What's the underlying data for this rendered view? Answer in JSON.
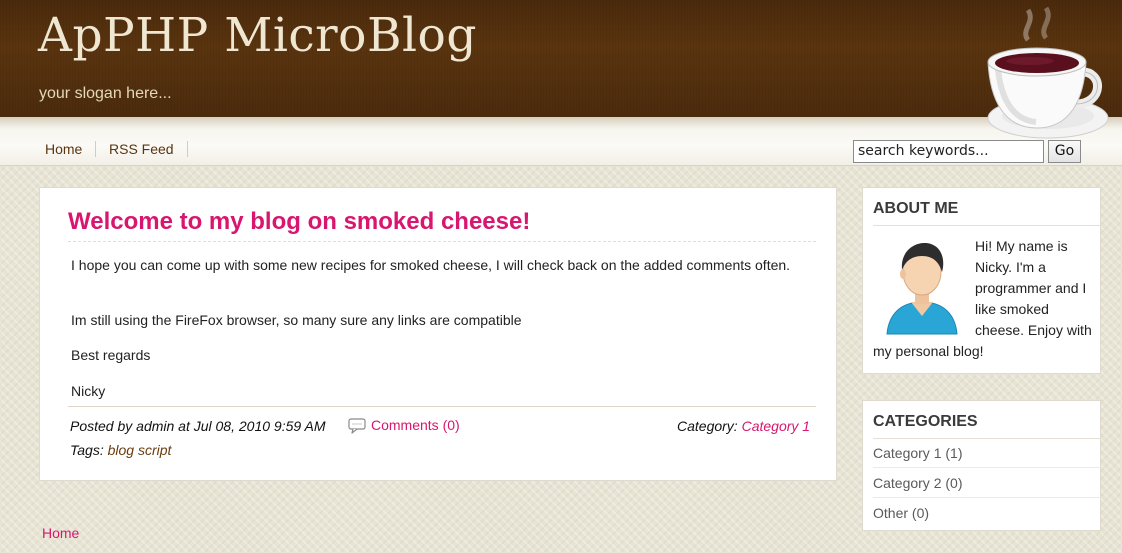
{
  "header": {
    "site_title": "ApPHP MicroBlog",
    "slogan": "your slogan here..."
  },
  "nav": {
    "items": [
      {
        "label": "Home"
      },
      {
        "label": "RSS Feed"
      }
    ]
  },
  "search": {
    "value": "search keywords...",
    "button_label": "Go"
  },
  "post": {
    "title": "Welcome to my blog on smoked cheese!",
    "paragraphs": [
      "I hope you can come up with some new recipes for smoked cheese, I will check back on the added comments often.",
      "Im still using the FireFox browser, so many sure any links are compatible",
      "Best regards",
      "Nicky"
    ],
    "posted_by": "Posted by admin at Jul 08, 2010 9:59 AM",
    "comments_label": "Comments (0)",
    "category_label": "Category:",
    "category_value": "Category 1",
    "tags_label": "Tags:",
    "tags_value": "blog script"
  },
  "sidebar": {
    "about": {
      "title": "ABOUT ME",
      "text": "Hi! My name is Nicky. I'm a programmer and I like smoked cheese. Enjoy with my personal blog!"
    },
    "categories": {
      "title": "CATEGORIES",
      "items": [
        {
          "label": "Category 1 (1)"
        },
        {
          "label": "Category 2 (0)"
        },
        {
          "label": "Other (0)"
        }
      ]
    }
  },
  "footer": {
    "home_label": "Home"
  },
  "colors": {
    "header_brown": "#4e2d0d",
    "accent_pink": "#d8166f",
    "nav_link_brown": "#5a3510",
    "page_background": "#e8e4d4"
  },
  "icons": [
    "coffee-cup-logo",
    "comment-icon",
    "user-avatar-icon"
  ]
}
